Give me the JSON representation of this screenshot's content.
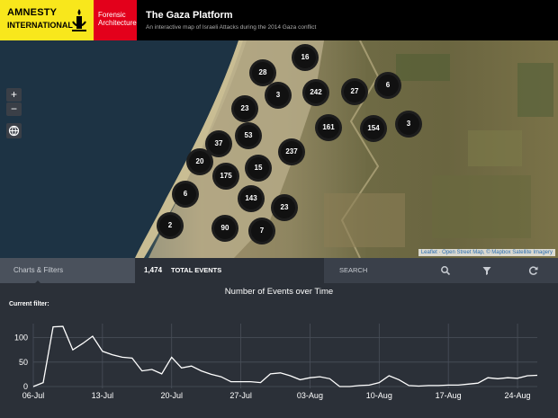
{
  "header": {
    "amnesty_line1": "AMNESTY",
    "amnesty_line2": "INTERNATIONAL",
    "forensic_label": "Forensic Architecture",
    "title": "The Gaza Platform",
    "subtitle": "An interactive map of Israeli Attacks during the 2014 Gaza conflict"
  },
  "map": {
    "zoom_in": "+",
    "zoom_out": "−",
    "attribution": "Leaflet · Open Street Map, © Mapbox Satellite Imagery",
    "clusters": [
      "16",
      "28",
      "3",
      "242",
      "27",
      "6",
      "23",
      "161",
      "154",
      "3",
      "37",
      "53",
      "237",
      "20",
      "175",
      "15",
      "6",
      "143",
      "23",
      "2",
      "90",
      "7"
    ]
  },
  "filterbar": {
    "charts_filters": "Charts & Filters",
    "total_count": "1,474",
    "total_label": "TOTAL EVENTS",
    "search_label": "SEARCH"
  },
  "chart": {
    "current_filter_label": "Current filter:"
  },
  "colors": {
    "amnesty_yellow": "#f8e71c",
    "forensic_red": "#e3001b",
    "panel_bg": "#2b3038",
    "line": "#ffffff"
  },
  "chart_data": {
    "type": "line",
    "title": "Number of Events over Time",
    "xlabel": "",
    "ylabel": "",
    "x_ticks": [
      "06-Jul",
      "13-Jul",
      "20-Jul",
      "27-Jul",
      "03-Aug",
      "10-Aug",
      "17-Aug",
      "24-Aug"
    ],
    "y_ticks": [
      0,
      50,
      100
    ],
    "ylim": [
      0,
      125
    ],
    "grid": true,
    "x": [
      "2014-07-06",
      "2014-07-07",
      "2014-07-08",
      "2014-07-09",
      "2014-07-10",
      "2014-07-11",
      "2014-07-12",
      "2014-07-13",
      "2014-07-14",
      "2014-07-15",
      "2014-07-16",
      "2014-07-17",
      "2014-07-18",
      "2014-07-19",
      "2014-07-20",
      "2014-07-21",
      "2014-07-22",
      "2014-07-23",
      "2014-07-24",
      "2014-07-25",
      "2014-07-26",
      "2014-07-27",
      "2014-07-28",
      "2014-07-29",
      "2014-07-30",
      "2014-07-31",
      "2014-08-01",
      "2014-08-02",
      "2014-08-03",
      "2014-08-04",
      "2014-08-05",
      "2014-08-06",
      "2014-08-07",
      "2014-08-08",
      "2014-08-09",
      "2014-08-10",
      "2014-08-11",
      "2014-08-12",
      "2014-08-13",
      "2014-08-14",
      "2014-08-15",
      "2014-08-16",
      "2014-08-17",
      "2014-08-18",
      "2014-08-19",
      "2014-08-20",
      "2014-08-21",
      "2014-08-22",
      "2014-08-23",
      "2014-08-24",
      "2014-08-25",
      "2014-08-26"
    ],
    "values": [
      0,
      8,
      122,
      123,
      75,
      88,
      103,
      72,
      65,
      60,
      58,
      32,
      35,
      26,
      60,
      38,
      42,
      32,
      25,
      20,
      10,
      10,
      10,
      8,
      26,
      28,
      22,
      14,
      18,
      20,
      16,
      0,
      0,
      2,
      3,
      8,
      22,
      14,
      2,
      1,
      2,
      2,
      3,
      3,
      5,
      7,
      18,
      16,
      18,
      17,
      22,
      23
    ]
  }
}
